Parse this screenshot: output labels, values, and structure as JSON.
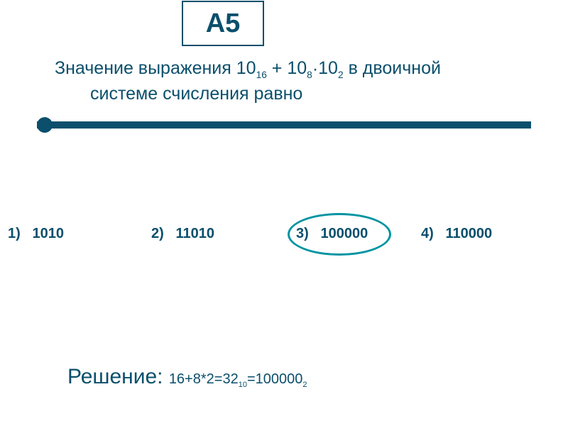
{
  "badge": {
    "label": "А5"
  },
  "question": {
    "prefix": "Значение выражения 10",
    "sub1": "16",
    "mid1": " + 10",
    "sub2": "8",
    "dot": " · ",
    "mid2": "10",
    "sub3": "2",
    "tail": " в двоичной",
    "line2": "системе счисления равно"
  },
  "options": [
    {
      "num": "1)",
      "val": "1010"
    },
    {
      "num": "2)",
      "val": "11010"
    },
    {
      "num": "3)",
      "val": "100000"
    },
    {
      "num": "4)",
      "val": "110000"
    }
  ],
  "correct": 2,
  "solution": {
    "label": "Решение: ",
    "expr_a": "16+8*2=32",
    "sub_a": "10",
    "eq": "=100000",
    "sub_b": "2"
  }
}
